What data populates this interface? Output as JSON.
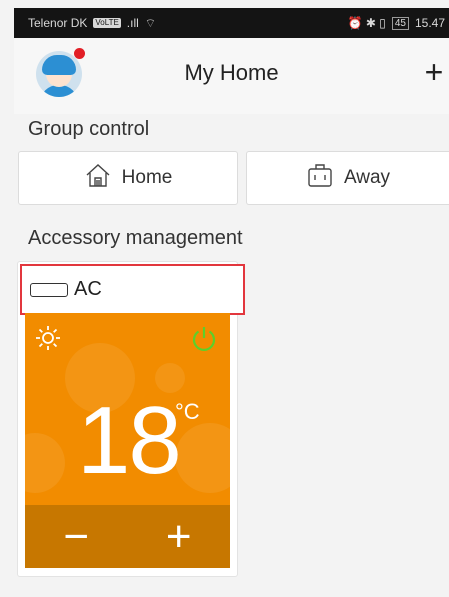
{
  "status_bar": {
    "carrier": "Telenor DK",
    "carrier_chip": "VoLTE",
    "signal": ".ıll",
    "wifi": "⌔",
    "right_icons": "⏰ ✱ ▯",
    "battery": "45",
    "time": "15.47"
  },
  "header": {
    "title": "My Home",
    "add_label": "+"
  },
  "group_control": {
    "label": "Group control",
    "buttons": [
      {
        "label": "Home",
        "icon": "home-icon"
      },
      {
        "label": "Away",
        "icon": "suitcase-icon"
      }
    ]
  },
  "accessory_management": {
    "label": "Accessory management",
    "device": {
      "name": "AC",
      "mode_icon": "sun-icon",
      "power_icon": "power-icon",
      "temperature": "18",
      "unit": "°C",
      "minus": "−",
      "plus": "+"
    }
  },
  "colors": {
    "card_orange": "#f28c00",
    "card_footer": "#c77700",
    "power_green": "#5cd02b",
    "highlight_red": "#e2363d",
    "notification_dot": "#e21e26"
  }
}
